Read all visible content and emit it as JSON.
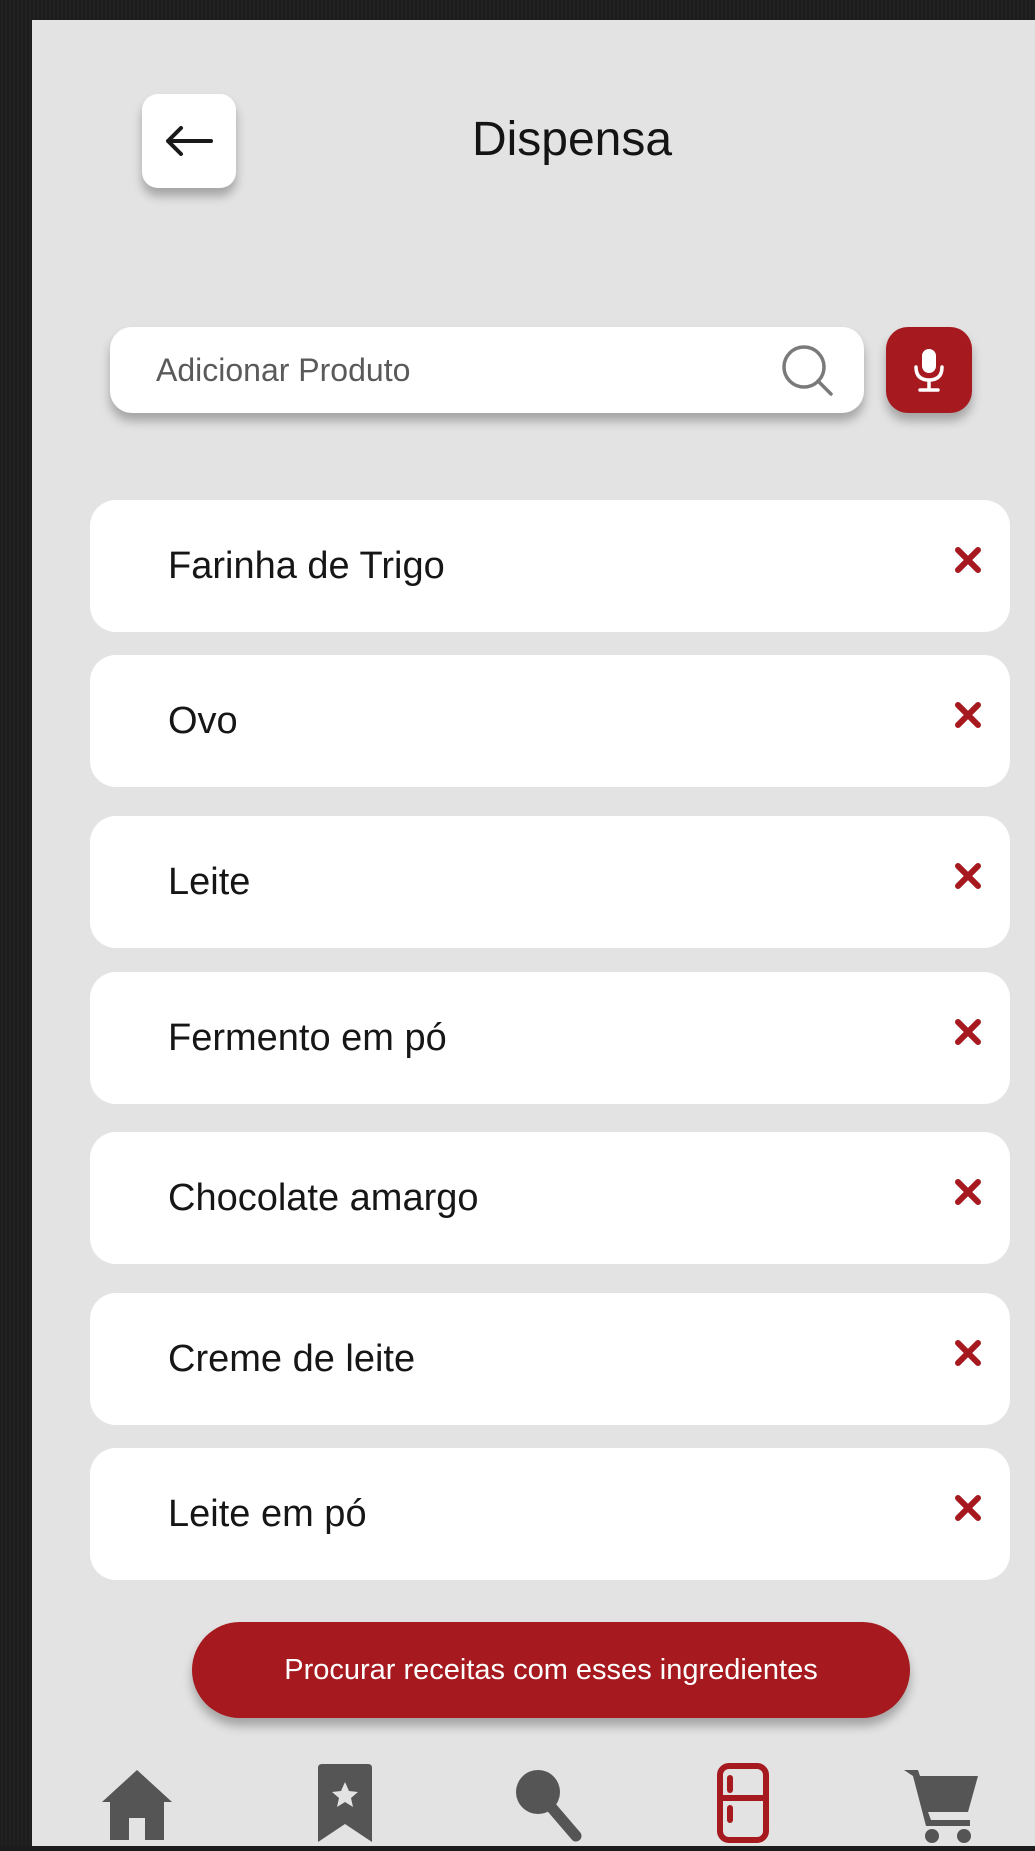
{
  "header": {
    "title": "Dispensa",
    "back_icon": "arrow-left-icon"
  },
  "search": {
    "placeholder": "Adicionar Produto",
    "value": "",
    "search_icon": "search-icon",
    "mic_icon": "microphone-icon"
  },
  "pantry_items": [
    {
      "label": "Farinha de Trigo"
    },
    {
      "label": "Ovo"
    },
    {
      "label": "Leite"
    },
    {
      "label": "Fermento em pó"
    },
    {
      "label": "Chocolate amargo"
    },
    {
      "label": "Creme de leite"
    },
    {
      "label": "Leite em pó"
    }
  ],
  "remove_icon": "close-icon",
  "cta": {
    "label": "Procurar receitas com esses ingredientes"
  },
  "bottom_nav": [
    {
      "name": "home",
      "icon": "home-icon",
      "active": false
    },
    {
      "name": "saved",
      "icon": "bookmark-star-icon",
      "active": false
    },
    {
      "name": "search",
      "icon": "search-icon",
      "active": false
    },
    {
      "name": "pantry",
      "icon": "fridge-icon",
      "active": true
    },
    {
      "name": "cart",
      "icon": "cart-icon",
      "active": false
    }
  ],
  "colors": {
    "accent": "#a6191e",
    "background": "#e3e3e3",
    "card": "#ffffff",
    "nav_inactive": "#555555"
  }
}
